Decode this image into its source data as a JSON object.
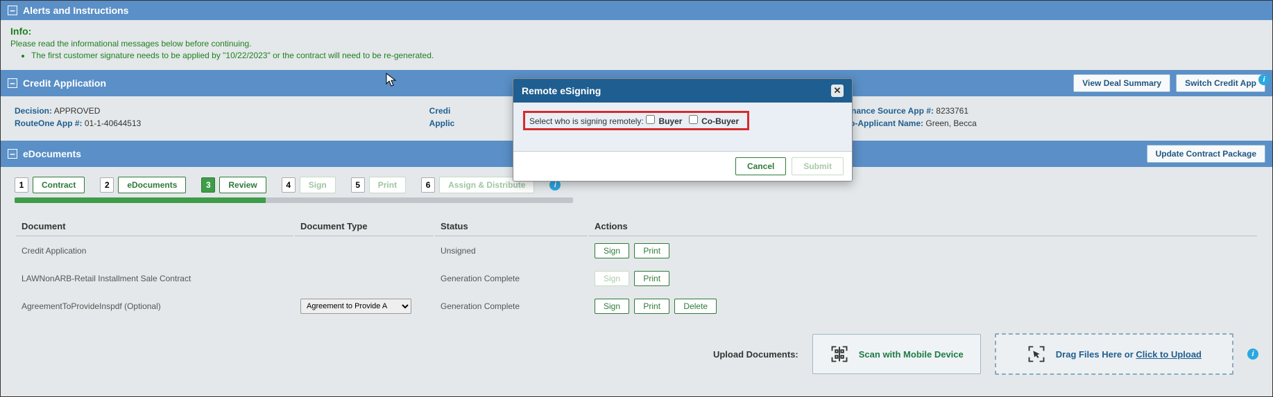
{
  "alerts": {
    "header": "Alerts and Instructions",
    "info_title": "Info:",
    "info_text": "Please read the informational messages below before continuing.",
    "bullet1": "The first customer signature needs to be applied by \"10/22/2023\" or the contract will need to be re-generated."
  },
  "credit": {
    "header": "Credit Application",
    "view_deal": "View Deal Summary",
    "switch_app": "Switch Credit App",
    "decision_label": "Decision:",
    "decision_value": "APPROVED",
    "routeone_label": "RouteOne App #:",
    "routeone_value": "01-1-40644513",
    "credit_label_partial": "Credi",
    "applicant_label_partial": "Applic",
    "finsource_label": "Finance Source App #:",
    "finsource_value": "8233761",
    "coapp_label": "Co-Applicant Name:",
    "coapp_value": "Green, Becca"
  },
  "edoc": {
    "header": "eDocuments",
    "update_btn": "Update Contract Package",
    "steps": [
      {
        "num": "1",
        "label": "Contract",
        "active": false,
        "disabled": false
      },
      {
        "num": "2",
        "label": "eDocuments",
        "active": false,
        "disabled": false
      },
      {
        "num": "3",
        "label": "Review",
        "active": true,
        "disabled": false
      },
      {
        "num": "4",
        "label": "Sign",
        "active": false,
        "disabled": true
      },
      {
        "num": "5",
        "label": "Print",
        "active": false,
        "disabled": true
      },
      {
        "num": "6",
        "label": "Assign & Distribute",
        "active": false,
        "disabled": true
      }
    ],
    "progress_pct": 45,
    "columns": {
      "doc": "Document",
      "type": "Document Type",
      "status": "Status",
      "actions": "Actions"
    },
    "rows": [
      {
        "doc": "Credit Application",
        "type": "",
        "status": "Unsigned",
        "actions": [
          {
            "label": "Sign",
            "disabled": false
          },
          {
            "label": "Print",
            "disabled": false
          }
        ]
      },
      {
        "doc": "LAWNonARB-Retail Installment Sale Contract",
        "type": "",
        "status": "Generation Complete",
        "actions": [
          {
            "label": "Sign",
            "disabled": true
          },
          {
            "label": "Print",
            "disabled": false
          }
        ]
      },
      {
        "doc": "AgreementToProvideInspdf (Optional)",
        "type_select": "Agreement to Provide A",
        "status": "Generation Complete",
        "actions": [
          {
            "label": "Sign",
            "disabled": false
          },
          {
            "label": "Print",
            "disabled": false
          },
          {
            "label": "Delete",
            "disabled": false
          }
        ]
      }
    ],
    "upload_label": "Upload Documents:",
    "scan_label": "Scan with Mobile Device",
    "drop_text": "Drag Files Here or ",
    "drop_link": "Click to Upload"
  },
  "modal": {
    "title": "Remote eSigning",
    "prompt": "Select who is signing remotely:",
    "buyer": "Buyer",
    "cobuyer": "Co-Buyer",
    "cancel": "Cancel",
    "submit": "Submit"
  }
}
